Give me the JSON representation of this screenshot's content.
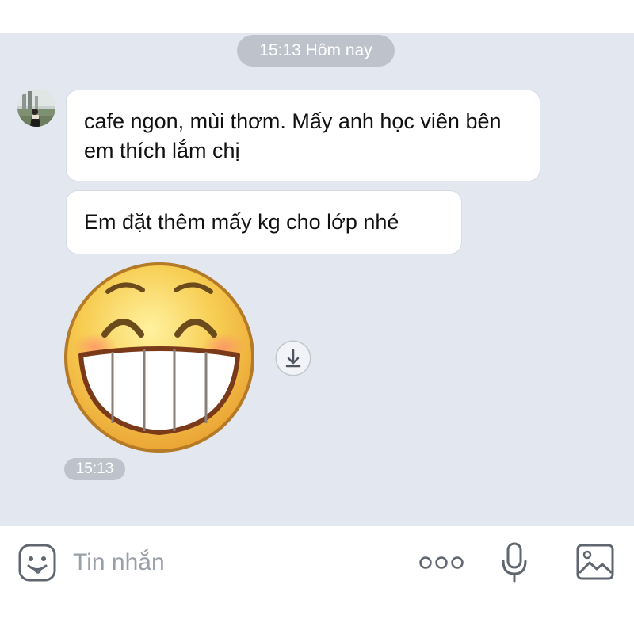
{
  "chat": {
    "date_separator": "15:13 Hôm nay",
    "messages": [
      {
        "text": "cafe ngon, mùi thơm. Mấy anh học viên bên em thích lắm chị"
      },
      {
        "text": "Em đặt thêm mấy kg cho lớp nhé"
      }
    ],
    "sticker": "grinning-face-sticker",
    "sticker_time": "15:13"
  },
  "input_bar": {
    "placeholder": "Tin nhắn",
    "icons": [
      "emoji-icon",
      "more-icon",
      "microphone-icon",
      "image-icon"
    ]
  },
  "colors": {
    "chat_background": "#e3e7ef",
    "pill_background": "#bec3cb",
    "bubble_background": "#ffffff",
    "icon_gray": "#5f6670"
  }
}
